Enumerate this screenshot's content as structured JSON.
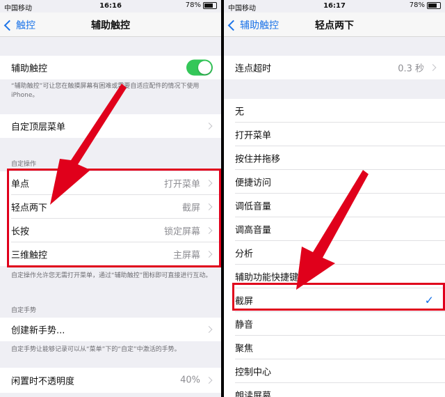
{
  "left": {
    "status": {
      "carrier": "中国移动",
      "time": "16:16",
      "battery": "78%"
    },
    "nav": {
      "back": "触控",
      "title": "辅助触控"
    },
    "toggle_row": {
      "label": "辅助触控",
      "on": true
    },
    "toggle_note": "“辅助触控”可让您在触摸屏幕有困难或需要自适应配件的情况下使用iPhone。",
    "top_menu": {
      "label": "自定顶层菜单"
    },
    "custom_actions_header": "自定操作",
    "actions": [
      {
        "label": "单点",
        "value": "打开菜单"
      },
      {
        "label": "轻点两下",
        "value": "截屏"
      },
      {
        "label": "长按",
        "value": "锁定屏幕"
      },
      {
        "label": "三维触控",
        "value": "主屏幕"
      }
    ],
    "actions_note": "自定操作允许您无需打开菜单，通过“辅助触控”图标即可直接进行互动。",
    "gestures_header": "自定手势",
    "new_gesture": {
      "label": "创建新手势..."
    },
    "gesture_note": "自定手势让能够记录可以从“菜单”下的“自定”中激活的手势。",
    "opacity": {
      "label": "闲置时不透明度",
      "value": "40%"
    }
  },
  "right": {
    "status": {
      "carrier": "中国移动",
      "time": "16:17",
      "battery": "78%"
    },
    "nav": {
      "back": "辅助触控",
      "title": "轻点两下"
    },
    "timeout": {
      "label": "连点超时",
      "value": "0.3 秒"
    },
    "options": [
      {
        "label": "无"
      },
      {
        "label": "打开菜单"
      },
      {
        "label": "按住并拖移"
      },
      {
        "label": "便捷访问"
      },
      {
        "label": "调低音量"
      },
      {
        "label": "调高音量"
      },
      {
        "label": "分析"
      },
      {
        "label": "辅助功能快捷键"
      },
      {
        "label": "截屏"
      },
      {
        "label": "静音"
      },
      {
        "label": "聚焦"
      },
      {
        "label": "控制中心"
      },
      {
        "label": "朗读屏幕"
      }
    ],
    "selected_option": "截屏"
  },
  "colors": {
    "accent": "#1a73e8",
    "toggle_on": "#34c759",
    "annotation_red": "#e0001b"
  }
}
